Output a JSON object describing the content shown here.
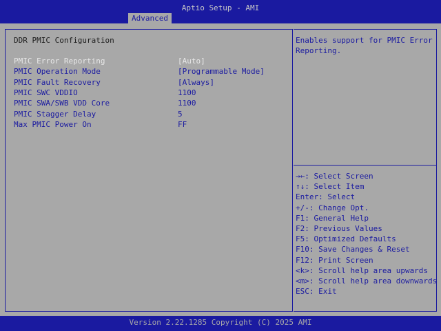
{
  "header": {
    "title": "Aptio Setup - AMI",
    "tabs": [
      {
        "label": "Advanced",
        "active": true
      }
    ]
  },
  "main": {
    "section_title": "DDR PMIC Configuration",
    "settings": [
      {
        "label": "PMIC Error Reporting",
        "value": "[Auto]",
        "selected": true
      },
      {
        "label": "PMIC Operation Mode",
        "value": "[Programmable Mode]",
        "selected": false
      },
      {
        "label": "PMIC Fault Recovery",
        "value": "[Always]",
        "selected": false
      },
      {
        "label": "PMIC SWC VDDIO",
        "value": "1100",
        "selected": false
      },
      {
        "label": "PMIC SWA/SWB VDD Core",
        "value": "1100",
        "selected": false
      },
      {
        "label": "PMIC Stagger Delay",
        "value": "5",
        "selected": false
      },
      {
        "label": "Max PMIC Power On",
        "value": "FF",
        "selected": false
      }
    ]
  },
  "help": {
    "text": "Enables support for PMIC Error\nReporting."
  },
  "keys": [
    "→←: Select Screen",
    "↑↓: Select Item",
    "Enter: Select",
    "+/-: Change Opt.",
    "F1: General Help",
    "F2: Previous Values",
    "F5: Optimized Defaults",
    "F10: Save Changes & Reset",
    "F12: Print Screen",
    "<k>: Scroll help area upwards",
    "<m>: Scroll help area downwards",
    "ESC: Exit"
  ],
  "footer": {
    "text": "Version 2.22.1285 Copyright (C) 2025 AMI"
  },
  "colors": {
    "frame_blue": "#1a1aa0",
    "panel_gray": "#a8a8a8",
    "selected_text": "#e8e8e8"
  }
}
